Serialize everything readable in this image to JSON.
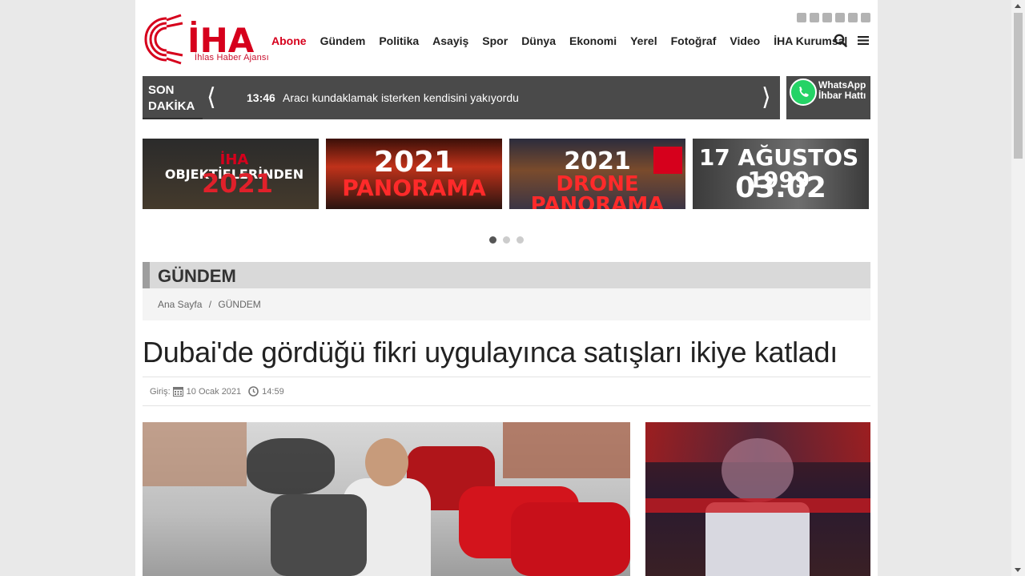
{
  "header": {
    "logo_text": "İHA",
    "logo_subtitle": "İhlas Haber Ajansı",
    "nav": [
      "Abone",
      "Gündem",
      "Politika",
      "Asayiş",
      "Spor",
      "Dünya",
      "Ekonomi",
      "Yerel",
      "Fotoğraf",
      "Video",
      "İHA Kurumsal"
    ],
    "social_icons": [
      "facebook-icon",
      "twitter-icon",
      "linkedin-icon",
      "instagram-icon",
      "youtube-icon",
      "rss-icon"
    ]
  },
  "breaking": {
    "label_line1": "SON",
    "label_line2": "DAKİKA",
    "time": "13:46",
    "text": "Aracı kundaklamak isterken kendisini yakıyordu"
  },
  "whatsapp": {
    "line1": "WhatsApp",
    "line2": "İhbar Hattı"
  },
  "banners": [
    {
      "brand": "İHA",
      "title": "OBJEKTİFLERİNDEN",
      "year": "2021"
    },
    {
      "year": "2021",
      "title": "PANORAMA"
    },
    {
      "year": "2021",
      "title": "DRONE PANORAMA"
    },
    {
      "title": "17 AĞUSTOS 1999",
      "time": "03.02"
    }
  ],
  "carousel": {
    "pages": 3,
    "active": 1
  },
  "section": {
    "title": "GÜNDEM"
  },
  "breadcrumb": {
    "home": "Ana Sayfa",
    "separator": "/",
    "current": "GÜNDEM"
  },
  "article": {
    "title": "Dubai'de gördüğü fikri uygulayınca satışları ikiye katladı",
    "entry_label": "Giriş:",
    "date": "10 Ocak 2021",
    "time": "14:59"
  },
  "colors": {
    "brand_red": "#d6001c",
    "bar_gray": "#4a4a4a"
  }
}
